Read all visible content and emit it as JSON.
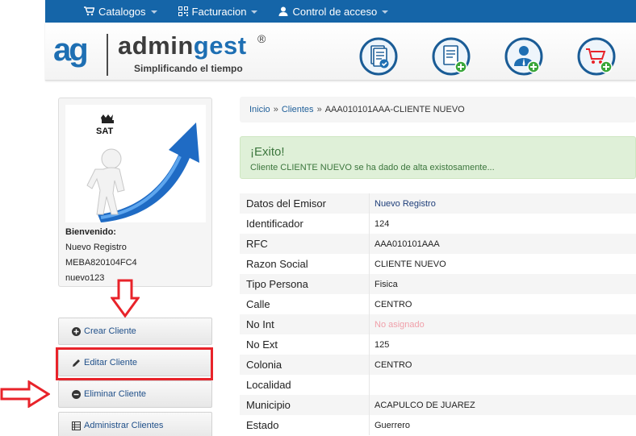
{
  "nav": {
    "items": [
      {
        "label": "Catalogos",
        "icon": "cart-icon"
      },
      {
        "label": "Facturacion",
        "icon": "qrcode-icon"
      },
      {
        "label": "Control de acceso",
        "icon": "user-icon"
      }
    ]
  },
  "header": {
    "logo_mark": "ag",
    "logo_name_a": "admin",
    "logo_name_b": "gest",
    "logo_reg": "®",
    "tagline": "Simplificando el tiempo",
    "icons": [
      "invoice-check-icon",
      "document-add-icon",
      "user-add-icon",
      "cart-add-icon"
    ]
  },
  "profile": {
    "image_label": "SAT",
    "welcome_label": "Bienvenido:",
    "name": "Nuevo Registro",
    "rfc": "MEBA820104FC4",
    "username": "nuevo123"
  },
  "menu": {
    "items": [
      {
        "label": "Crear Cliente",
        "icon": "plus-circle-icon"
      },
      {
        "label": "Editar Cliente",
        "icon": "pencil-icon"
      },
      {
        "label": "Eliminar Cliente",
        "icon": "minus-circle-icon"
      },
      {
        "label": "Administrar Clientes",
        "icon": "list-icon"
      }
    ]
  },
  "breadcrumb": {
    "home": "Inicio",
    "clients": "Clientes",
    "current": "AAA010101AAA-CLIENTE NUEVO",
    "separator": "»"
  },
  "alert": {
    "title": "¡Exito!",
    "message": "Cliente CLIENTE NUEVO se ha dado de alta existosamente..."
  },
  "details": {
    "rows": [
      {
        "label": "Datos del Emisor",
        "value": "Nuevo Registro"
      },
      {
        "label": "Identificador",
        "value": "124"
      },
      {
        "label": "RFC",
        "value": "AAA010101AAA"
      },
      {
        "label": "Razon Social",
        "value": "CLIENTE NUEVO"
      },
      {
        "label": "Tipo Persona",
        "value": "Fisica"
      },
      {
        "label": "Calle",
        "value": "CENTRO"
      },
      {
        "label": "No Int",
        "value": "No asignado"
      },
      {
        "label": "No Ext",
        "value": "125"
      },
      {
        "label": "Colonia",
        "value": "CENTRO"
      },
      {
        "label": "Localidad",
        "value": ""
      },
      {
        "label": "Municipio",
        "value": "ACAPULCO DE JUAREZ"
      },
      {
        "label": "Estado",
        "value": "Guerrero"
      }
    ]
  },
  "colors": {
    "nav_bg": "#1565a8",
    "brand_blue": "#1e6fb3",
    "success_bg": "#dff0d8",
    "success_text": "#3c763d",
    "highlight_red": "#e8232a"
  }
}
